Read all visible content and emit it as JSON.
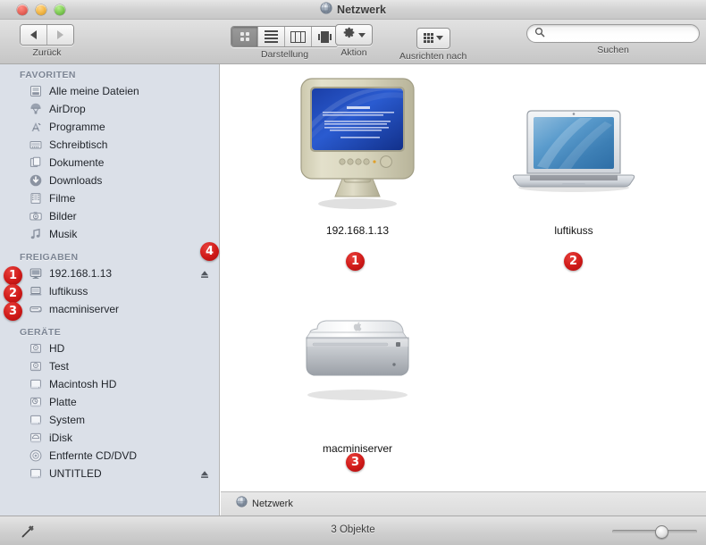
{
  "window": {
    "title": "Netzwerk",
    "title_icon": "globe-icon",
    "controls": {
      "close": "close",
      "minimize": "minimize",
      "zoom": "zoom"
    }
  },
  "toolbar": {
    "nav": {
      "label": "Zurück",
      "back_icon": "arrow-left-icon",
      "forward_icon": "arrow-right-icon"
    },
    "view": {
      "label": "Darstellung",
      "modes": [
        {
          "name": "icon-view",
          "icon": "grid-icon",
          "selected": true
        },
        {
          "name": "list-view",
          "icon": "list-icon",
          "selected": false
        },
        {
          "name": "column-view",
          "icon": "columns-icon",
          "selected": false
        },
        {
          "name": "coverflow-view",
          "icon": "coverflow-icon",
          "selected": false
        }
      ]
    },
    "action": {
      "label": "Aktion",
      "icon": "gear-icon"
    },
    "arrange": {
      "label": "Ausrichten nach",
      "icon": "grid-small-icon"
    },
    "search": {
      "label": "Suchen",
      "placeholder": "",
      "value": "",
      "icon": "search-icon"
    }
  },
  "sidebar": {
    "sections": [
      {
        "header": "FAVORITEN",
        "items": [
          {
            "label": "Alle meine Dateien",
            "icon": "all-files-icon"
          },
          {
            "label": "AirDrop",
            "icon": "airdrop-icon"
          },
          {
            "label": "Programme",
            "icon": "applications-icon"
          },
          {
            "label": "Schreibtisch",
            "icon": "desktop-icon"
          },
          {
            "label": "Dokumente",
            "icon": "documents-icon"
          },
          {
            "label": "Downloads",
            "icon": "downloads-icon"
          },
          {
            "label": "Filme",
            "icon": "movies-icon"
          },
          {
            "label": "Bilder",
            "icon": "pictures-icon"
          },
          {
            "label": "Musik",
            "icon": "music-icon"
          }
        ]
      },
      {
        "header": "FREIGABEN",
        "items": [
          {
            "label": "192.168.1.13",
            "icon": "crt-display-icon",
            "eject": true,
            "badge": "1"
          },
          {
            "label": "luftikuss",
            "icon": "laptop-icon",
            "eject": false,
            "badge": "2"
          },
          {
            "label": "macminiserver",
            "icon": "server-icon",
            "eject": false,
            "badge": "3"
          }
        ]
      },
      {
        "header": "GERÄTE",
        "items": [
          {
            "label": "HD",
            "icon": "internal-disk-icon"
          },
          {
            "label": "Test",
            "icon": "internal-disk-icon"
          },
          {
            "label": "Macintosh HD",
            "icon": "hard-disk-icon"
          },
          {
            "label": "Platte",
            "icon": "time-machine-disk-icon"
          },
          {
            "label": "System",
            "icon": "hard-disk-icon"
          },
          {
            "label": "iDisk",
            "icon": "idisk-icon"
          },
          {
            "label": "Entfernte CD/DVD",
            "icon": "optical-disc-icon"
          },
          {
            "label": "UNTITLED",
            "icon": "hard-disk-icon",
            "eject": true
          }
        ]
      }
    ],
    "eject_badge": "4"
  },
  "content": {
    "items": [
      {
        "label": "192.168.1.13",
        "icon": "crt-monitor-icon",
        "badge": "1"
      },
      {
        "label": "luftikuss",
        "icon": "macbook-air-icon",
        "badge": "2"
      },
      {
        "label": "macminiserver",
        "icon": "mac-mini-icon",
        "badge": "3"
      }
    ]
  },
  "pathbar": {
    "label": "Netzwerk",
    "icon": "globe-icon"
  },
  "statusbar": {
    "text": "3 Objekte",
    "resize_icon": "resize-grip-icon",
    "zoom_slider": {
      "name": "icon-size-slider",
      "value": 52
    }
  },
  "colors": {
    "badge_red": "#cf1a18",
    "sidebar_bg": "#dbe0e8",
    "sidebar_header": "#7c8594",
    "content_bg": "#ffffff",
    "toolbar_top": "#e2e2e2",
    "toolbar_bottom": "#c6c6c6"
  }
}
